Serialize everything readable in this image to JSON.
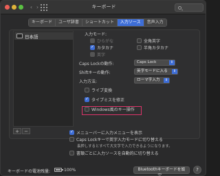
{
  "window": {
    "title": "キーボード"
  },
  "tabs": [
    {
      "label": "キーボード",
      "active": false
    },
    {
      "label": "ユーザ辞書",
      "active": false
    },
    {
      "label": "ショートカット",
      "active": false
    },
    {
      "label": "入力ソース",
      "active": true
    },
    {
      "label": "音声入力",
      "active": false
    }
  ],
  "sources": {
    "items": [
      {
        "label": "日本語"
      }
    ],
    "add": "+",
    "remove": "−"
  },
  "settings": {
    "input_mode_label": "入力モード:",
    "modes": [
      {
        "label": "ひらがな",
        "checked": true,
        "enabled": false
      },
      {
        "label": "全角英字",
        "checked": false,
        "enabled": true
      },
      {
        "label": "カタカナ",
        "checked": true,
        "enabled": true
      },
      {
        "label": "半角カタカナ",
        "checked": false,
        "enabled": true
      },
      {
        "label": "英字",
        "checked": true,
        "enabled": false
      }
    ],
    "caps_label": "Caps Lockの動作:",
    "caps_value": "Caps Lock",
    "shift_label": "Shiftキーの動作:",
    "shift_value": "英字モードに入る",
    "input_method_label": "入力方法:",
    "input_method_value": "ローマ字入力",
    "live_conversion": {
      "label": "ライブ変換",
      "checked": false
    },
    "typo_fix": {
      "label": "タイプミスを修正",
      "checked": true
    },
    "windows_keys": {
      "label": "Windows風のキー操作",
      "checked": false
    }
  },
  "options": {
    "menu_bar": {
      "label": "メニューバーに入力メニューを表示",
      "checked": true
    },
    "caps_switch": {
      "label": "Caps Lockキーで英字入力モードに切り替える",
      "checked": false
    },
    "caps_switch_sub": "長押しするとすべて大文字で入力できるようになります。",
    "auto_switch": {
      "label": "書類ごとに入力ソースを自動的に切り替える",
      "checked": false
    }
  },
  "footer": {
    "battery_label": "キーボードの電池残量:",
    "battery_pct": "100%",
    "bluetooth_button": "Bluetoothキーボードを設定...",
    "help": "?"
  },
  "colors": {
    "accent": "#3e6ed7",
    "highlight": "#e0356b",
    "window_bg": "#2a2a2b"
  },
  "icons": [
    "close-button",
    "minimize-button",
    "zoom-button",
    "back-chevron",
    "forward-chevron",
    "grid-icon",
    "search-icon",
    "battery-icon",
    "help-icon",
    "language-flag-icon"
  ]
}
